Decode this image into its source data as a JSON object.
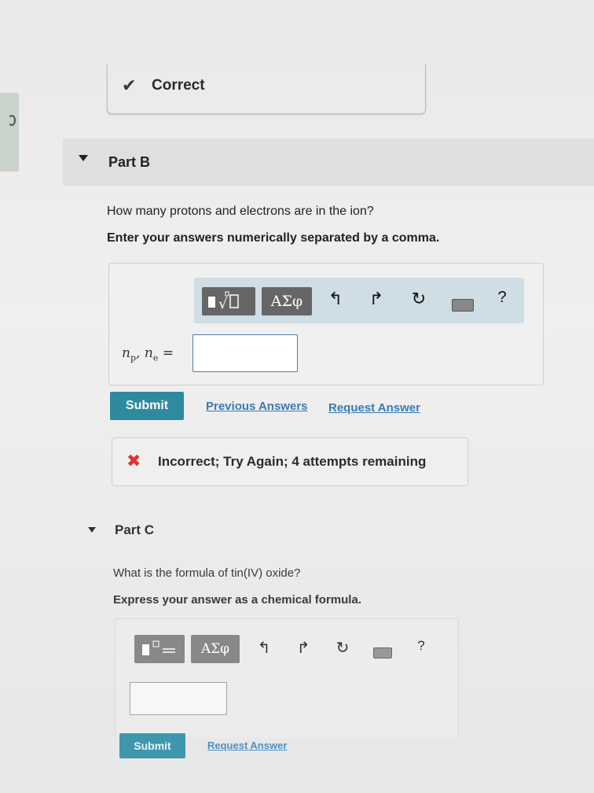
{
  "part_a": {
    "feedback": "Correct"
  },
  "part_b": {
    "title": "Part B",
    "question": "How many protons and electrons are in the ion?",
    "instruction": "Enter your answers numerically separated by a comma.",
    "toolbar": {
      "greek_label": "ΑΣφ",
      "help_label": "?"
    },
    "math_label": {
      "n": "n",
      "p": "p",
      "e": "e",
      "sep": ",",
      "eq": "="
    },
    "answer_value": "",
    "submit_label": "Submit",
    "previous_answers_label": "Previous Answers",
    "request_answer_label": "Request Answer",
    "feedback": "Incorrect; Try Again; 4 attempts remaining"
  },
  "part_c": {
    "title": "Part C",
    "question": "What is the formula of tin(IV) oxide?",
    "instruction": "Express your answer as a chemical formula.",
    "toolbar": {
      "greek_label": "ΑΣφ",
      "help_label": "?"
    },
    "answer_value": "",
    "submit_label": "Submit",
    "request_answer_label": "Request Answer"
  },
  "colors": {
    "submit_bg": "#2f8a9f",
    "link": "#3a7ab3",
    "toolbar_bg": "#cfdde4",
    "error_icon": "#dd3333"
  },
  "icons": [
    "checkmark-icon",
    "templates-icon",
    "undo-icon",
    "redo-icon",
    "reset-icon",
    "keyboard-icon",
    "help-icon",
    "error-x-icon",
    "collapse-triangle-icon"
  ]
}
